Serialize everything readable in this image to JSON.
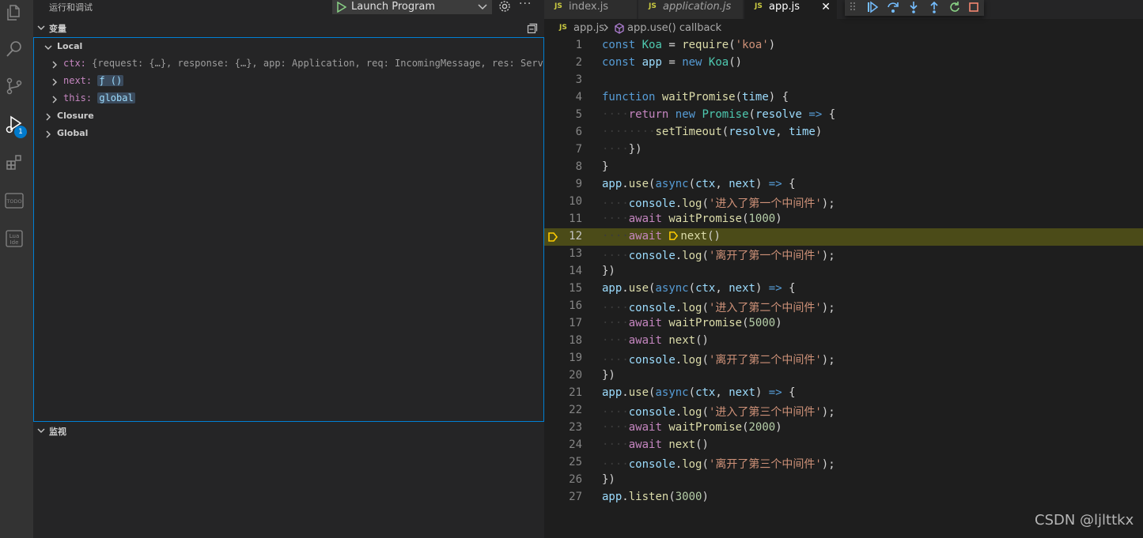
{
  "sidebar": {
    "title": "运行和调试",
    "config": "Launch Program",
    "sections": {
      "variables": "变量",
      "watch": "监视"
    },
    "variables": {
      "local_label": "Local",
      "ctx_name": "ctx:",
      "ctx_value": "{request: {…}, response: {…}, app: Application, req: IncomingMessage, res: Serv…",
      "next_name": "next:",
      "next_value": "ƒ ()",
      "this_name": "this:",
      "this_value": "global",
      "closure_label": "Closure",
      "global_label": "Global"
    }
  },
  "activity": {
    "debug_badge": "1"
  },
  "tabs": [
    {
      "label": "index.js",
      "icon": "JS"
    },
    {
      "label": "application.js",
      "icon": "JS"
    },
    {
      "label": "app.js",
      "icon": "JS",
      "close": "✕"
    }
  ],
  "breadcrumb": {
    "file": "app.js",
    "symbol": "app.use() callback"
  },
  "editor": {
    "paused_line": 12,
    "lines": [
      {
        "n": "1",
        "t": "const Koa = require('koa')"
      },
      {
        "n": "2",
        "t": "const app = new Koa()"
      },
      {
        "n": "3",
        "t": ""
      },
      {
        "n": "4",
        "t": "function waitPromise(time) {"
      },
      {
        "n": "5",
        "t": "    return new Promise(resolve => {"
      },
      {
        "n": "6",
        "t": "        setTimeout(resolve, time)"
      },
      {
        "n": "7",
        "t": "    })"
      },
      {
        "n": "8",
        "t": "}"
      },
      {
        "n": "9",
        "t": "app.use(async(ctx, next) => {"
      },
      {
        "n": "10",
        "t": "    console.log('进入了第一个中间件');"
      },
      {
        "n": "11",
        "t": "    await waitPromise(1000)"
      },
      {
        "n": "12",
        "t": "    await next()"
      },
      {
        "n": "13",
        "t": "    console.log('离开了第一个中间件');"
      },
      {
        "n": "14",
        "t": "})"
      },
      {
        "n": "15",
        "t": "app.use(async(ctx, next) => {"
      },
      {
        "n": "16",
        "t": "    console.log('进入了第二个中间件');"
      },
      {
        "n": "17",
        "t": "    await waitPromise(5000)"
      },
      {
        "n": "18",
        "t": "    await next()"
      },
      {
        "n": "19",
        "t": "    console.log('离开了第二个中间件');"
      },
      {
        "n": "20",
        "t": "})"
      },
      {
        "n": "21",
        "t": "app.use(async(ctx, next) => {"
      },
      {
        "n": "22",
        "t": "    console.log('进入了第三个中间件');"
      },
      {
        "n": "23",
        "t": "    await waitPromise(2000)"
      },
      {
        "n": "24",
        "t": "    await next()"
      },
      {
        "n": "25",
        "t": "    console.log('离开了第三个中间件');"
      },
      {
        "n": "26",
        "t": "})"
      },
      {
        "n": "27",
        "t": "app.listen(3000)"
      }
    ]
  },
  "watermark": "CSDN @ljlttkx",
  "colors": {
    "accent": "#007acc",
    "paused_line": "#4b4b18",
    "keyword": "#569cd6",
    "control": "#c586c0",
    "string": "#ce9178",
    "function": "#dcdcaa",
    "variable": "#9cdcfe",
    "class": "#4ec9b0",
    "number": "#b5cea8"
  }
}
